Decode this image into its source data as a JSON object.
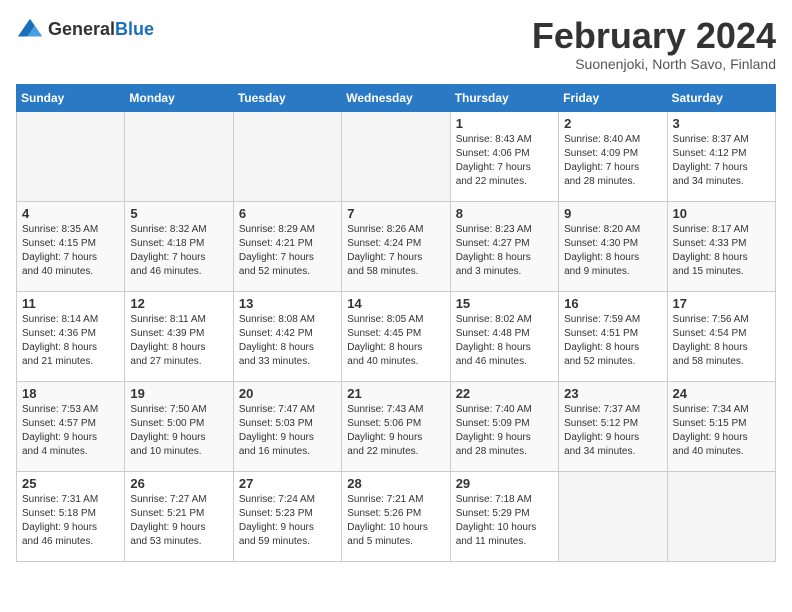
{
  "logo": {
    "general": "General",
    "blue": "Blue"
  },
  "header": {
    "month": "February 2024",
    "location": "Suonenjoki, North Savo, Finland"
  },
  "days_of_week": [
    "Sunday",
    "Monday",
    "Tuesday",
    "Wednesday",
    "Thursday",
    "Friday",
    "Saturday"
  ],
  "weeks": [
    [
      {
        "num": "",
        "info": ""
      },
      {
        "num": "",
        "info": ""
      },
      {
        "num": "",
        "info": ""
      },
      {
        "num": "",
        "info": ""
      },
      {
        "num": "1",
        "info": "Sunrise: 8:43 AM\nSunset: 4:06 PM\nDaylight: 7 hours\nand 22 minutes."
      },
      {
        "num": "2",
        "info": "Sunrise: 8:40 AM\nSunset: 4:09 PM\nDaylight: 7 hours\nand 28 minutes."
      },
      {
        "num": "3",
        "info": "Sunrise: 8:37 AM\nSunset: 4:12 PM\nDaylight: 7 hours\nand 34 minutes."
      }
    ],
    [
      {
        "num": "4",
        "info": "Sunrise: 8:35 AM\nSunset: 4:15 PM\nDaylight: 7 hours\nand 40 minutes."
      },
      {
        "num": "5",
        "info": "Sunrise: 8:32 AM\nSunset: 4:18 PM\nDaylight: 7 hours\nand 46 minutes."
      },
      {
        "num": "6",
        "info": "Sunrise: 8:29 AM\nSunset: 4:21 PM\nDaylight: 7 hours\nand 52 minutes."
      },
      {
        "num": "7",
        "info": "Sunrise: 8:26 AM\nSunset: 4:24 PM\nDaylight: 7 hours\nand 58 minutes."
      },
      {
        "num": "8",
        "info": "Sunrise: 8:23 AM\nSunset: 4:27 PM\nDaylight: 8 hours\nand 3 minutes."
      },
      {
        "num": "9",
        "info": "Sunrise: 8:20 AM\nSunset: 4:30 PM\nDaylight: 8 hours\nand 9 minutes."
      },
      {
        "num": "10",
        "info": "Sunrise: 8:17 AM\nSunset: 4:33 PM\nDaylight: 8 hours\nand 15 minutes."
      }
    ],
    [
      {
        "num": "11",
        "info": "Sunrise: 8:14 AM\nSunset: 4:36 PM\nDaylight: 8 hours\nand 21 minutes."
      },
      {
        "num": "12",
        "info": "Sunrise: 8:11 AM\nSunset: 4:39 PM\nDaylight: 8 hours\nand 27 minutes."
      },
      {
        "num": "13",
        "info": "Sunrise: 8:08 AM\nSunset: 4:42 PM\nDaylight: 8 hours\nand 33 minutes."
      },
      {
        "num": "14",
        "info": "Sunrise: 8:05 AM\nSunset: 4:45 PM\nDaylight: 8 hours\nand 40 minutes."
      },
      {
        "num": "15",
        "info": "Sunrise: 8:02 AM\nSunset: 4:48 PM\nDaylight: 8 hours\nand 46 minutes."
      },
      {
        "num": "16",
        "info": "Sunrise: 7:59 AM\nSunset: 4:51 PM\nDaylight: 8 hours\nand 52 minutes."
      },
      {
        "num": "17",
        "info": "Sunrise: 7:56 AM\nSunset: 4:54 PM\nDaylight: 8 hours\nand 58 minutes."
      }
    ],
    [
      {
        "num": "18",
        "info": "Sunrise: 7:53 AM\nSunset: 4:57 PM\nDaylight: 9 hours\nand 4 minutes."
      },
      {
        "num": "19",
        "info": "Sunrise: 7:50 AM\nSunset: 5:00 PM\nDaylight: 9 hours\nand 10 minutes."
      },
      {
        "num": "20",
        "info": "Sunrise: 7:47 AM\nSunset: 5:03 PM\nDaylight: 9 hours\nand 16 minutes."
      },
      {
        "num": "21",
        "info": "Sunrise: 7:43 AM\nSunset: 5:06 PM\nDaylight: 9 hours\nand 22 minutes."
      },
      {
        "num": "22",
        "info": "Sunrise: 7:40 AM\nSunset: 5:09 PM\nDaylight: 9 hours\nand 28 minutes."
      },
      {
        "num": "23",
        "info": "Sunrise: 7:37 AM\nSunset: 5:12 PM\nDaylight: 9 hours\nand 34 minutes."
      },
      {
        "num": "24",
        "info": "Sunrise: 7:34 AM\nSunset: 5:15 PM\nDaylight: 9 hours\nand 40 minutes."
      }
    ],
    [
      {
        "num": "25",
        "info": "Sunrise: 7:31 AM\nSunset: 5:18 PM\nDaylight: 9 hours\nand 46 minutes."
      },
      {
        "num": "26",
        "info": "Sunrise: 7:27 AM\nSunset: 5:21 PM\nDaylight: 9 hours\nand 53 minutes."
      },
      {
        "num": "27",
        "info": "Sunrise: 7:24 AM\nSunset: 5:23 PM\nDaylight: 9 hours\nand 59 minutes."
      },
      {
        "num": "28",
        "info": "Sunrise: 7:21 AM\nSunset: 5:26 PM\nDaylight: 10 hours\nand 5 minutes."
      },
      {
        "num": "29",
        "info": "Sunrise: 7:18 AM\nSunset: 5:29 PM\nDaylight: 10 hours\nand 11 minutes."
      },
      {
        "num": "",
        "info": ""
      },
      {
        "num": "",
        "info": ""
      }
    ]
  ]
}
